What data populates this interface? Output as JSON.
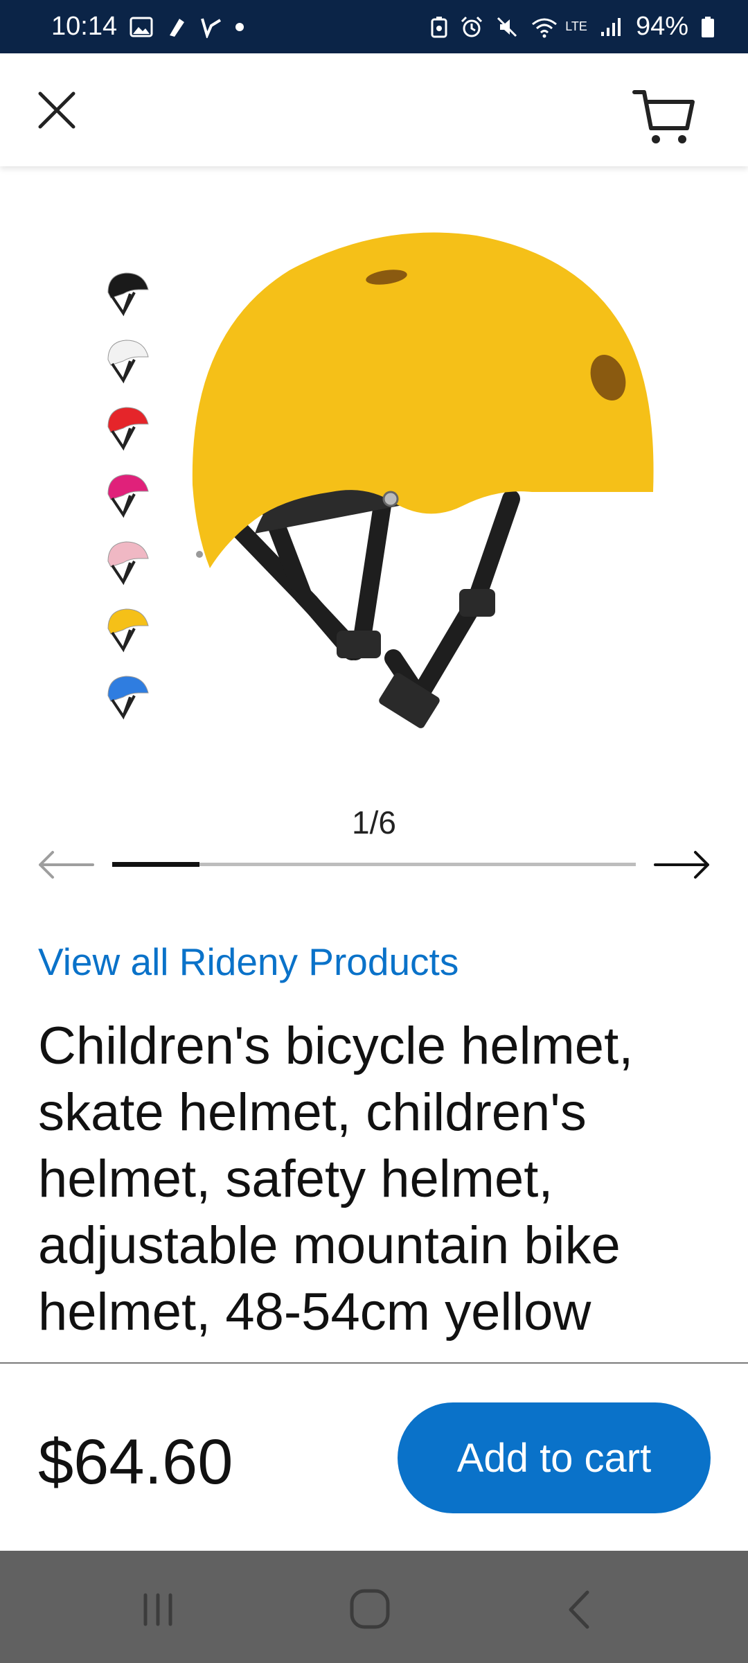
{
  "status_bar": {
    "time": "10:14",
    "battery": "94%",
    "background_color": "#0b2447",
    "left_icons": [
      "gallery-icon",
      "app-notification-icon",
      "app-notification-icon",
      "dot-icon"
    ],
    "right_icons": [
      "battery-saver-icon",
      "alarm-icon",
      "mute-icon",
      "wifi-icon",
      "lte-icon",
      "signal-icon",
      "battery-icon"
    ],
    "lte_label": "LTE"
  },
  "top_bar": {
    "close_icon": "close-icon",
    "cart_icon": "cart-icon"
  },
  "gallery": {
    "color_options": [
      "black",
      "white",
      "red",
      "pink",
      "light-pink",
      "yellow",
      "blue"
    ],
    "color_swatches": [
      "#1a1a1a",
      "#f2f2f2",
      "#e5252a",
      "#e0217a",
      "#f0b8c4",
      "#f5c018",
      "#2f7de0"
    ],
    "main_color": "#f5c018",
    "counter": "1/6",
    "current_page": 1,
    "total_pages": 6,
    "prev_icon": "arrow-left-icon",
    "next_icon": "arrow-right-icon"
  },
  "product": {
    "brand_link": "View all Rideny Products",
    "title": "Children's bicycle helmet, skate helmet, children's helmet, safety helmet, adjustable mountain bike helmet, 48-54cm yellow",
    "price": "$64.60"
  },
  "actions": {
    "add_to_cart": "Add to cart",
    "accent_color": "#0a72c9"
  },
  "nav_bar": {
    "buttons": [
      "recent-apps-icon",
      "home-icon",
      "back-icon"
    ]
  }
}
